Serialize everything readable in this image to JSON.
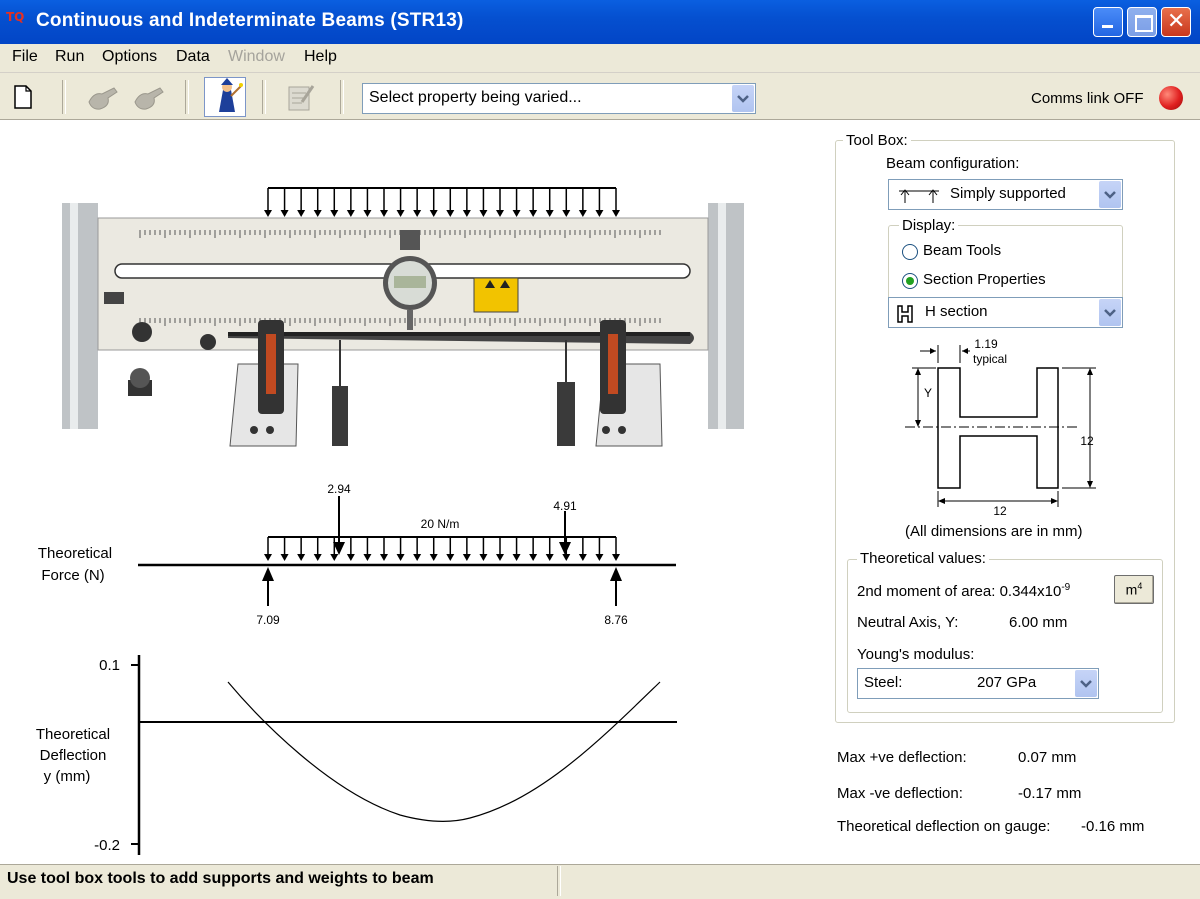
{
  "window": {
    "title": "Continuous and Indeterminate Beams (STR13)",
    "icon_text": "TQ"
  },
  "menu": [
    "File",
    "Run",
    "Options",
    "Data",
    "Window",
    "Help"
  ],
  "toolbar": {
    "property_select": "Select property being varied...",
    "comms_label": "Comms link OFF",
    "comms_color": "#e02020"
  },
  "toolbox": {
    "title": "Tool Box:",
    "beam_config_label": "Beam configuration:",
    "beam_config_value": "Simply supported",
    "display_label": "Display:",
    "radio_beam_tools": "Beam Tools",
    "radio_section_props": "Section Properties",
    "section_value": "H section",
    "section_dims": {
      "flange": "1.19",
      "typical": "typical",
      "y": "Y",
      "height": "12",
      "width": "12"
    },
    "dims_note": "(All dimensions are in mm)",
    "theoretical_title": "Theoretical values:",
    "moment_label": "2nd moment of area: 0.344x10",
    "moment_exp": "-9",
    "moment_unit": "m",
    "moment_unit_exp": "4",
    "neutral_label": "Neutral Axis, Y:",
    "neutral_value": "6.00 mm",
    "youngs_label": "Young's modulus:",
    "material": "Steel:",
    "material_value": "207 GPa"
  },
  "results": {
    "max_pos_label": "Max +ve deflection:",
    "max_pos_value": "0.07 mm",
    "max_neg_label": "Max -ve deflection:",
    "max_neg_value": "-0.17 mm",
    "gauge_label": "Theoretical deflection on gauge:",
    "gauge_value": "-0.16 mm"
  },
  "force_diagram": {
    "label_line1": "Theoretical",
    "label_line2": "Force (N)",
    "udl_label": "20 N/m",
    "point_load_1": "2.94",
    "point_load_2": "4.91",
    "reaction_left": "7.09",
    "reaction_right": "8.76"
  },
  "deflection_plot": {
    "label_line1": "Theoretical",
    "label_line2": "Deflection",
    "label_line3": "y (mm)",
    "y_top": "0.1",
    "y_bottom": "-0.2"
  },
  "status": "Use tool box tools to add supports and weights to beam"
}
